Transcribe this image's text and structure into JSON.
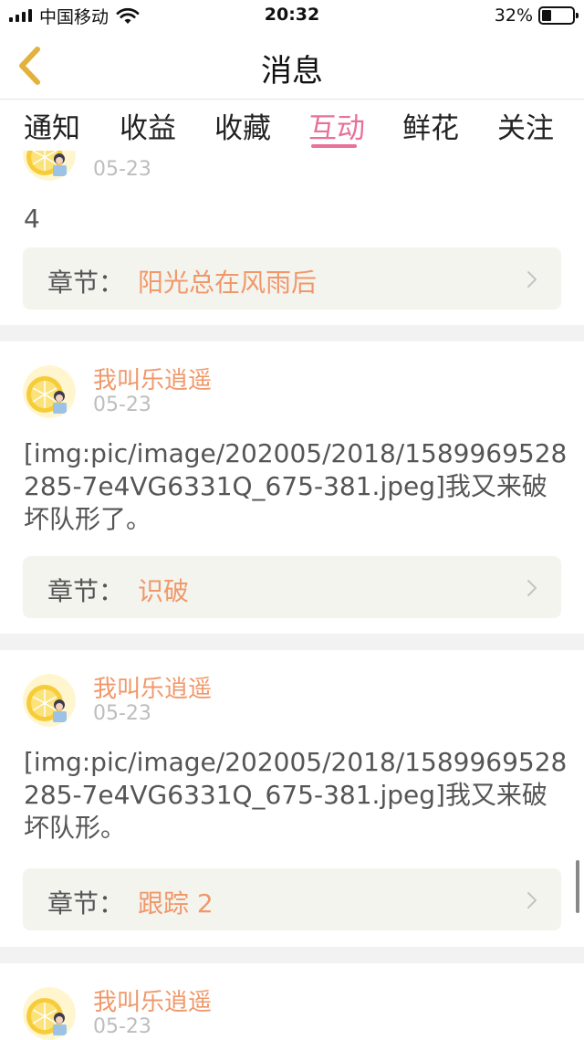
{
  "status_bar": {
    "carrier": "中国移动",
    "time": "20:32",
    "battery_percent": "32%",
    "battery_level": 0.32
  },
  "nav": {
    "title": "消息"
  },
  "tabs": [
    {
      "label": "通知"
    },
    {
      "label": "收益"
    },
    {
      "label": "收藏"
    },
    {
      "label": "互动",
      "active": true
    },
    {
      "label": "鲜花"
    },
    {
      "label": "关注"
    }
  ],
  "chapter_label": "章节：",
  "colors": {
    "accent_pink": "#e8709a",
    "username_orange": "#f0986a",
    "chapter_bg": "#f4f4ef"
  },
  "messages": [
    {
      "username": "",
      "date": "05-23",
      "text": "4",
      "chapter": "阳光总在风雨后"
    },
    {
      "username": "我叫乐逍遥",
      "date": "05-23",
      "text": "[img:pic/image/202005/2018/1589969528285-7e4VG6331Q_675-381.jpeg]我又来破坏队形了。",
      "chapter": "识破"
    },
    {
      "username": "我叫乐逍遥",
      "date": "05-23",
      "text": "[img:pic/image/202005/2018/1589969528285-7e4VG6331Q_675-381.jpeg]我又来破坏队形。",
      "chapter": "跟踪 2"
    },
    {
      "username": "我叫乐逍遥",
      "date": "05-23"
    }
  ]
}
